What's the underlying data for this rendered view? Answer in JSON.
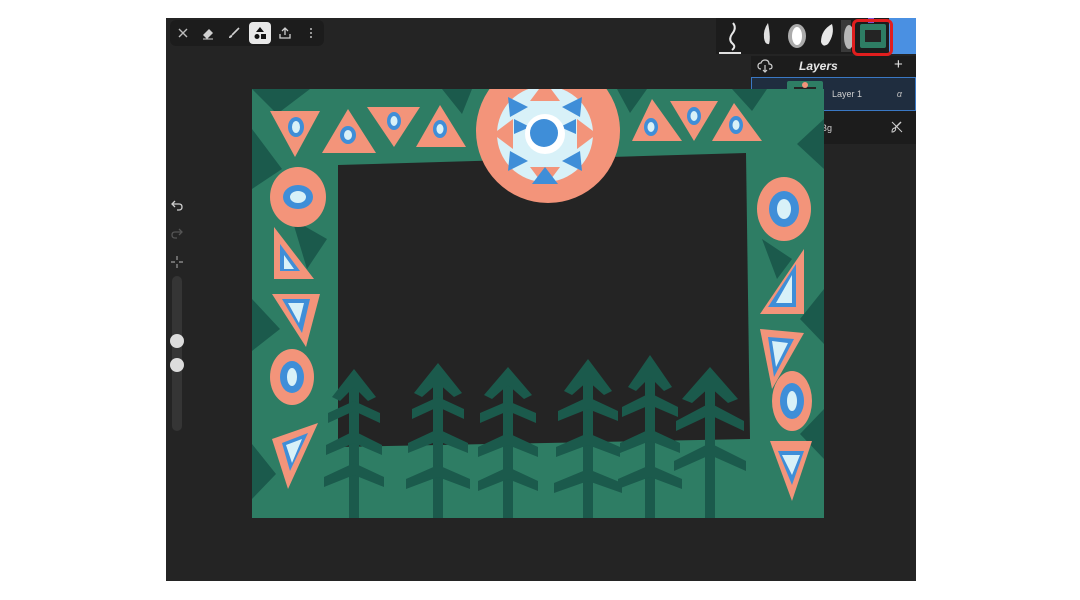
{
  "toolbar": {
    "tools": [
      {
        "name": "close",
        "icon": "close-icon"
      },
      {
        "name": "eraser",
        "icon": "eraser-icon"
      },
      {
        "name": "brush",
        "icon": "brush-icon"
      },
      {
        "name": "shapes",
        "icon": "shapes-icon",
        "active": true
      },
      {
        "name": "share",
        "icon": "share-icon"
      },
      {
        "name": "more",
        "icon": "more-icon"
      }
    ]
  },
  "brushes": {
    "slots": [
      "brush-preset-1",
      "brush-preset-2",
      "brush-preset-3",
      "brush-preset-4",
      "brush-preset-5"
    ],
    "active_color": "#4a90e2"
  },
  "layers": {
    "title": "Layers",
    "add_symbol": "+",
    "items": [
      {
        "name": "Layer 1",
        "mode": "α",
        "selected": true,
        "visible": true
      },
      {
        "name": "Bg",
        "visible": false
      }
    ]
  },
  "colors": {
    "canvas_green": "#2e7d64",
    "dark_green": "#1b5a4c",
    "salmon": "#f3947a",
    "blue": "#3f8ed8",
    "light_blue": "#d8f1f8",
    "highlight_red": "#e01e1e",
    "panel_dark": "#1c1c1c"
  }
}
